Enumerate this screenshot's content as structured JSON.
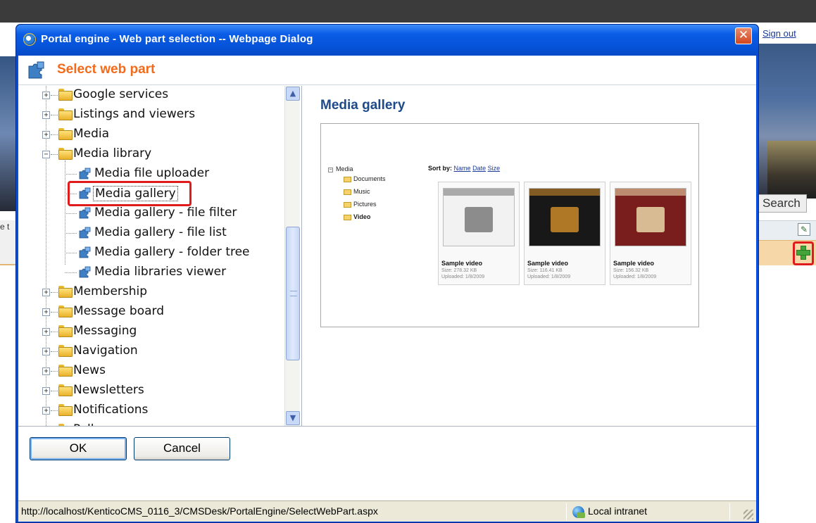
{
  "background": {
    "sign_out": "Sign out",
    "search_button": "Search",
    "left_fragment": "e t"
  },
  "dialog": {
    "title": "Portal engine - Web part selection -- Webpage Dialog",
    "close_glyph": "✕",
    "header_title": "Select web part"
  },
  "tree": {
    "items": [
      {
        "label": "Google services",
        "level": 0,
        "type": "folder",
        "expander": "+"
      },
      {
        "label": "Listings and viewers",
        "level": 0,
        "type": "folder",
        "expander": "+"
      },
      {
        "label": "Media",
        "level": 0,
        "type": "folder",
        "expander": "+"
      },
      {
        "label": "Media library",
        "level": 0,
        "type": "folder",
        "expander": "−"
      },
      {
        "label": "Media file uploader",
        "level": 1,
        "type": "webpart"
      },
      {
        "label": "Media gallery",
        "level": 1,
        "type": "webpart",
        "selected": true
      },
      {
        "label": "Media gallery - file filter",
        "level": 1,
        "type": "webpart"
      },
      {
        "label": "Media gallery - file list",
        "level": 1,
        "type": "webpart"
      },
      {
        "label": "Media gallery - folder tree",
        "level": 1,
        "type": "webpart"
      },
      {
        "label": "Media libraries viewer",
        "level": 1,
        "type": "webpart"
      },
      {
        "label": "Membership",
        "level": 0,
        "type": "folder",
        "expander": "+"
      },
      {
        "label": "Message board",
        "level": 0,
        "type": "folder",
        "expander": "+"
      },
      {
        "label": "Messaging",
        "level": 0,
        "type": "folder",
        "expander": "+"
      },
      {
        "label": "Navigation",
        "level": 0,
        "type": "folder",
        "expander": "+"
      },
      {
        "label": "News",
        "level": 0,
        "type": "folder",
        "expander": "+"
      },
      {
        "label": "Newsletters",
        "level": 0,
        "type": "folder",
        "expander": "+"
      },
      {
        "label": "Notifications",
        "level": 0,
        "type": "folder",
        "expander": "+"
      },
      {
        "label": "Polls",
        "level": 0,
        "type": "folder",
        "expander": "+"
      }
    ]
  },
  "preview": {
    "webpart_title": "Media gallery",
    "tree": {
      "root": "Media",
      "folders": [
        "Documents",
        "Music",
        "Pictures",
        "Video"
      ],
      "active": "Video"
    },
    "sort": {
      "label": "Sort by:",
      "options": [
        "Name",
        "Date",
        "Size"
      ]
    },
    "items": [
      {
        "name": "Sample video",
        "size": "Size:  278.32 KB",
        "uploaded": "Uploaded:  1/8/2009",
        "color": "#f2f2f2",
        "accent": "#7a7a7a"
      },
      {
        "name": "Sample video",
        "size": "Size:  116.41 KB",
        "uploaded": "Uploaded:  1/8/2009",
        "color": "#181818",
        "accent": "#c98a2a"
      },
      {
        "name": "Sample video",
        "size": "Size:  156.32 KB",
        "uploaded": "Uploaded:  1/8/2009",
        "color": "#7a1d1d",
        "accent": "#e9d7a8"
      }
    ]
  },
  "buttons": {
    "ok": "OK",
    "cancel": "Cancel"
  },
  "status": {
    "url": "http://localhost/KenticoCMS_0116_3/CMSDesk/PortalEngine/SelectWebPart.aspx",
    "zone": "Local intranet"
  },
  "colors": {
    "accent_orange": "#f26b1d",
    "title_blue": "#1e4a8a",
    "highlight_red": "#e01b1b",
    "xp_blue": "#0a5de6"
  }
}
